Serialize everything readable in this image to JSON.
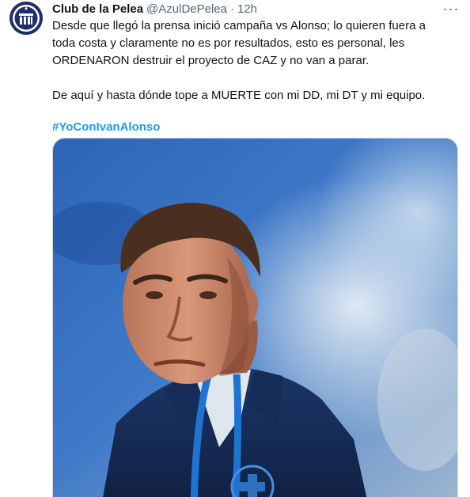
{
  "tweet": {
    "author": {
      "name": "Club de la Pelea",
      "handle": "@AzulDePelea",
      "separator": "·",
      "time": "12h",
      "avatar_icon": "club-crest-icon"
    },
    "more_icon": "more-dots-icon",
    "more_label": "···",
    "text": {
      "paragraph_1": "Desde que llegó la prensa inició campaña vs Alonso; lo quieren fuera a toda costa y claramente no es por resultados, esto es personal, les ORDENARON destruir el proyecto de CAZ y no van a parar.",
      "paragraph_2": "De aquí y hasta dónde tope a MUERTE con mi DD, mi DT y mi equipo."
    },
    "hashtag": "#YoConIvanAlonso",
    "media": {
      "kind": "photo",
      "subject": "coach-photo"
    }
  },
  "colors": {
    "text_primary": "#0f1419",
    "text_secondary": "#536471",
    "link": "#1d9bf0",
    "border": "#cfd9de",
    "avatar_bg": "#1f2f6b"
  }
}
